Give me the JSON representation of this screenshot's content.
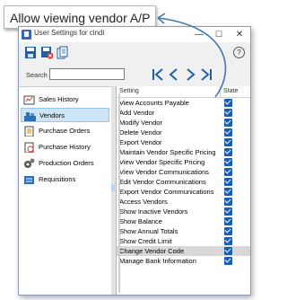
{
  "callout": {
    "text": "Allow viewing vendor A/P"
  },
  "window": {
    "title": "User Settings for cindi",
    "controls": {
      "minimize": "—",
      "maximize": "☐",
      "close": "✕"
    },
    "help": "?"
  },
  "search": {
    "label": "Search",
    "value": ""
  },
  "nav_buttons": {
    "first": "|<",
    "prev": "<",
    "next": ">",
    "last": ">|"
  },
  "sidebar": {
    "items": [
      {
        "label": "Sales History",
        "icon": "sales-history-icon"
      },
      {
        "label": "Vendors",
        "icon": "vendors-icon",
        "selected": true
      },
      {
        "label": "Purchase Orders",
        "icon": "purchase-orders-icon"
      },
      {
        "label": "Purchase History",
        "icon": "purchase-history-icon"
      },
      {
        "label": "Production Orders",
        "icon": "production-orders-icon"
      },
      {
        "label": "Requisitions",
        "icon": "requisitions-icon"
      }
    ]
  },
  "grid": {
    "headers": {
      "setting": "Setting",
      "state": "State"
    },
    "rows": [
      {
        "label": "View Accounts Payable",
        "checked": true
      },
      {
        "label": "Add Vendor",
        "checked": true
      },
      {
        "label": "Modify Vendor",
        "checked": true
      },
      {
        "label": "Delete Vendor",
        "checked": true
      },
      {
        "label": "Export Vendor",
        "checked": true
      },
      {
        "label": "Maintain Vendor Specific Pricing",
        "checked": true
      },
      {
        "label": "View Vendor Specific Pricing",
        "checked": true
      },
      {
        "label": "View Vendor Communications",
        "checked": true
      },
      {
        "label": "Edit Vendor Communications",
        "checked": true
      },
      {
        "label": "Export Vendor Communications",
        "checked": true
      },
      {
        "label": "Access Vendors",
        "checked": true
      },
      {
        "label": "Show Inactive Vendors",
        "checked": true
      },
      {
        "label": "Show Balance",
        "checked": true
      },
      {
        "label": "Show Annual Totals",
        "checked": true
      },
      {
        "label": "Show Credit Limit",
        "checked": true
      },
      {
        "label": "Change Vendor Code",
        "checked": true,
        "highlighted": true
      },
      {
        "label": "Manage Bank Information",
        "checked": true
      }
    ]
  },
  "colors": {
    "accent": "#1a5fb4",
    "selection": "#cde4f7",
    "highlight_row": "#d8d8d8"
  }
}
